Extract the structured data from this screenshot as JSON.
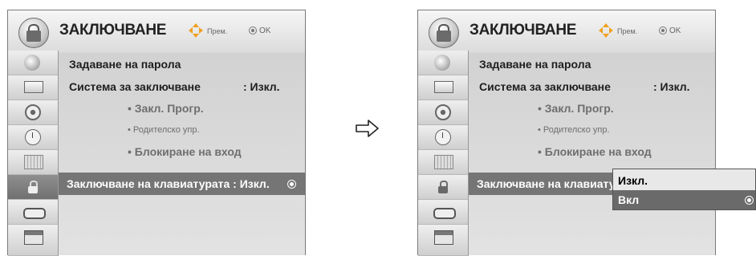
{
  "left_panel": {
    "title": "ЗАКЛЮЧВАНЕ",
    "nav_hint": "Прем.",
    "ok_hint": "OK",
    "items": {
      "set_password": "Задаване на парола",
      "lock_system": "Система за заключване",
      "lock_system_value": ": Изкл.",
      "block_program": "• Закл. Прогр.",
      "parental": "• Родителско упр.",
      "input_block": "• Блокиране на вход",
      "key_lock": "Заключване на клавиатурата : Изкл."
    }
  },
  "right_panel": {
    "title": "ЗАКЛЮЧВАНЕ",
    "nav_hint": "Прем.",
    "ok_hint": "OK",
    "items": {
      "set_password": "Задаване на парола",
      "lock_system": "Система за заключване",
      "lock_system_value": ": Изкл.",
      "block_program": "• Закл. Прогр.",
      "parental": "• Родителско упр.",
      "input_block": "• Блокиране на вход",
      "key_lock": "Заключване на клавиату"
    },
    "popup": {
      "options": [
        "Изкл.",
        "Вкл"
      ],
      "selected": "Вкл"
    }
  },
  "sidebar_icons": [
    "satellite-icon",
    "tv-icon",
    "speaker-icon",
    "clock-icon",
    "film-icon",
    "lock-icon",
    "plug-icon",
    "clapper-icon"
  ],
  "colors": {
    "highlight": "#757575",
    "nav_arrow": "#f0a020"
  }
}
